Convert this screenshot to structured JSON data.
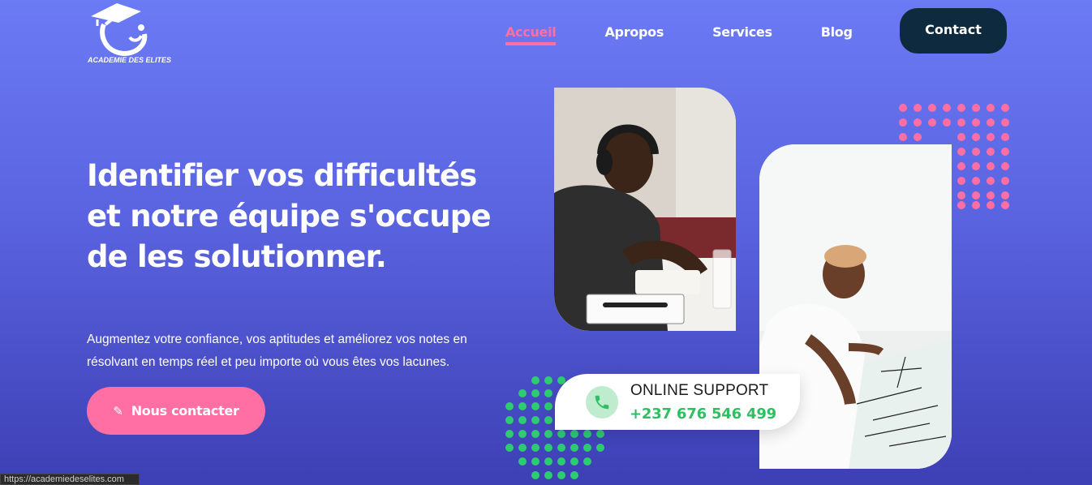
{
  "brand": {
    "name": "ACADEMIE DES ELITES",
    "logo_icon": "graduation-cap-logo-icon"
  },
  "nav": {
    "items": [
      {
        "label": "Accueil",
        "active": true
      },
      {
        "label": "Apropos",
        "active": false
      },
      {
        "label": "Services",
        "active": false
      },
      {
        "label": "Blog",
        "active": false
      }
    ],
    "contact_label": "Contact"
  },
  "hero": {
    "title": "Identifier vos difficultés et notre équipe s'occupe de les solutionner.",
    "subtitle": "Augmentez votre confiance, vos aptitudes et améliorez vos notes en résolvant en temps réel et peu importe où vous êtes vos lacunes.",
    "cta_label": "Nous contacter",
    "cta_icon": "edit-icon"
  },
  "support": {
    "label": "ONLINE SUPPORT",
    "phone": "+237 676 546 499",
    "icon": "phone-icon"
  },
  "status_bar": {
    "url": "https://academiedeselites.com"
  },
  "colors": {
    "accent_pink": "#ff6fa3",
    "dark_button": "#0d2a3f",
    "support_green": "#2fbf62",
    "dots_green": "#2ecc71"
  }
}
